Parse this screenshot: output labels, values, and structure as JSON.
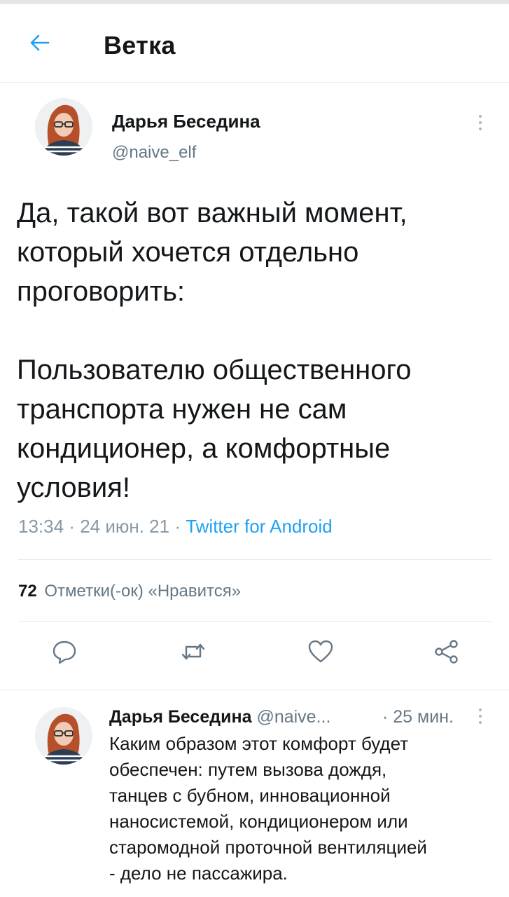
{
  "header": {
    "title": "Ветка",
    "back_icon": "arrow-left-icon",
    "accent": "#1da1f2"
  },
  "main_tweet": {
    "author": {
      "name": "Дарья Беседина",
      "handle": "@naive_elf"
    },
    "text_paragraphs": [
      [
        "Да, такой вот важный момент,",
        "который хочется отдельно",
        "проговорить:"
      ],
      [
        "Пользователю общественного",
        "транспорта нужен не сам",
        "кондиционер, а комфортные",
        "условия!"
      ]
    ],
    "meta": {
      "time": "13:34",
      "separator": " · ",
      "date": "24 июн. 21",
      "source": "Twitter for Android"
    },
    "likes": {
      "count": "72",
      "label": "Отметки(-ок) «Нравится»"
    },
    "actions": [
      {
        "name": "reply-button",
        "icon": "reply-icon"
      },
      {
        "name": "retweet-button",
        "icon": "retweet-icon"
      },
      {
        "name": "like-button",
        "icon": "heart-icon"
      },
      {
        "name": "share-button",
        "icon": "share-icon"
      }
    ]
  },
  "reply": {
    "author_name": "Дарья Беседина",
    "handle": "@naive...",
    "time": "25 мин.",
    "lines": [
      "Каким образом этот комфорт будет",
      "обеспечен: путем вызова дождя,",
      "танцев с бубном, инновационной",
      "наносистемой, кондиционером или",
      "старомодной проточной вентиляцией",
      "- дело не пассажира."
    ]
  },
  "colors": {
    "text": "#14171a",
    "secondary": "#657786",
    "muted": "#8899a6",
    "divider": "#e6ecf0",
    "link": "#1da1f2"
  }
}
